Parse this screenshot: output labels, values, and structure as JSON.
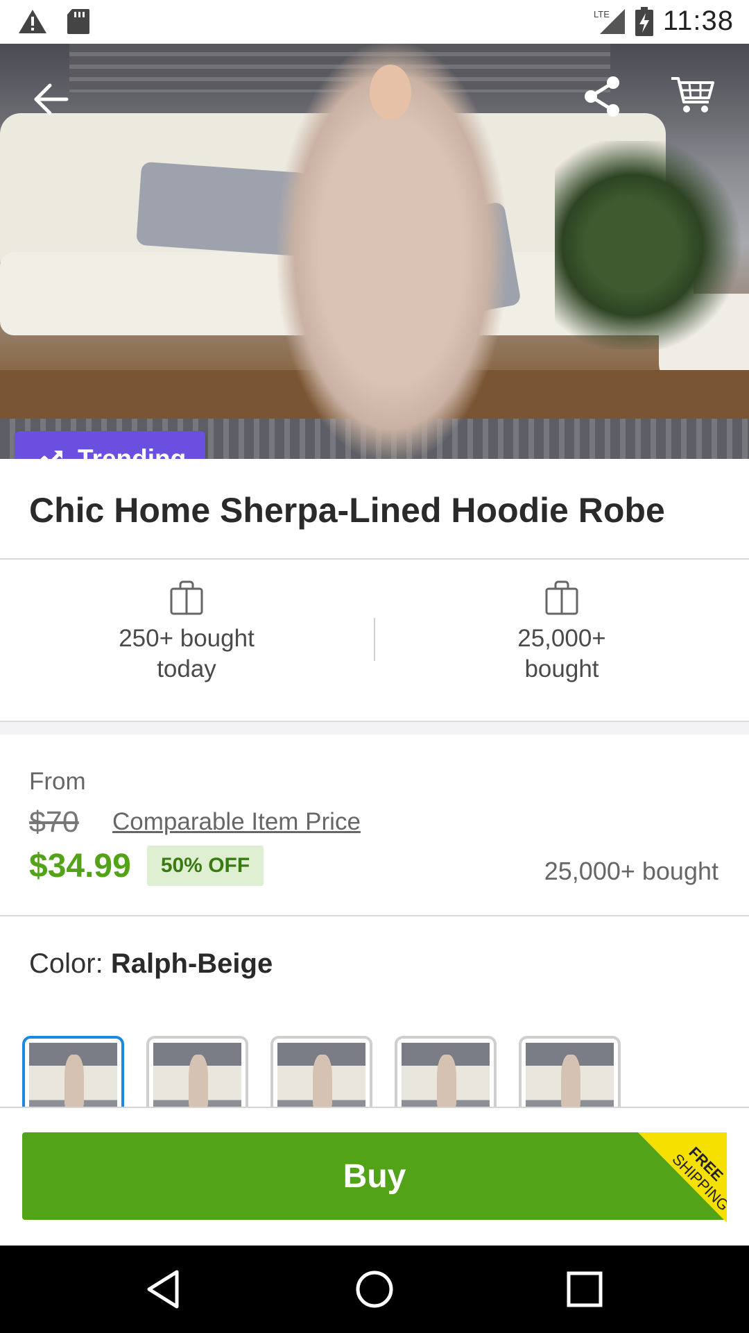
{
  "status_bar": {
    "time": "11:38",
    "network": "LTE",
    "icons": [
      "warning-icon",
      "sd-card-icon",
      "signal-icon",
      "battery-charging-icon"
    ]
  },
  "hero": {
    "badge_label": "Trending",
    "icons": [
      "back-arrow-icon",
      "share-icon",
      "cart-icon",
      "trending-up-icon"
    ]
  },
  "product": {
    "title": "Chic Home Sherpa-Lined Hoodie Robe"
  },
  "stats": {
    "today_line1": "250+ bought",
    "today_line2": "today",
    "total_line1": "25,000+",
    "total_line2": "bought"
  },
  "price": {
    "from_label": "From",
    "original": "$70",
    "comparable_label": "Comparable Item Price",
    "current": "$34.99",
    "discount": "50% OFF",
    "bought": "25,000+ bought"
  },
  "color": {
    "label": "Color:",
    "value": "Ralph-Beige",
    "variant_count_visible": 5,
    "selected_index": 0
  },
  "buy": {
    "label": "Buy",
    "ribbon_line1": "FREE",
    "ribbon_line2": "SHIPPING"
  },
  "colors": {
    "accent_purple": "#6a4fe0",
    "buy_green": "#53a318",
    "ribbon_yellow": "#f5e000",
    "selected_blue": "#1a8ae0"
  }
}
